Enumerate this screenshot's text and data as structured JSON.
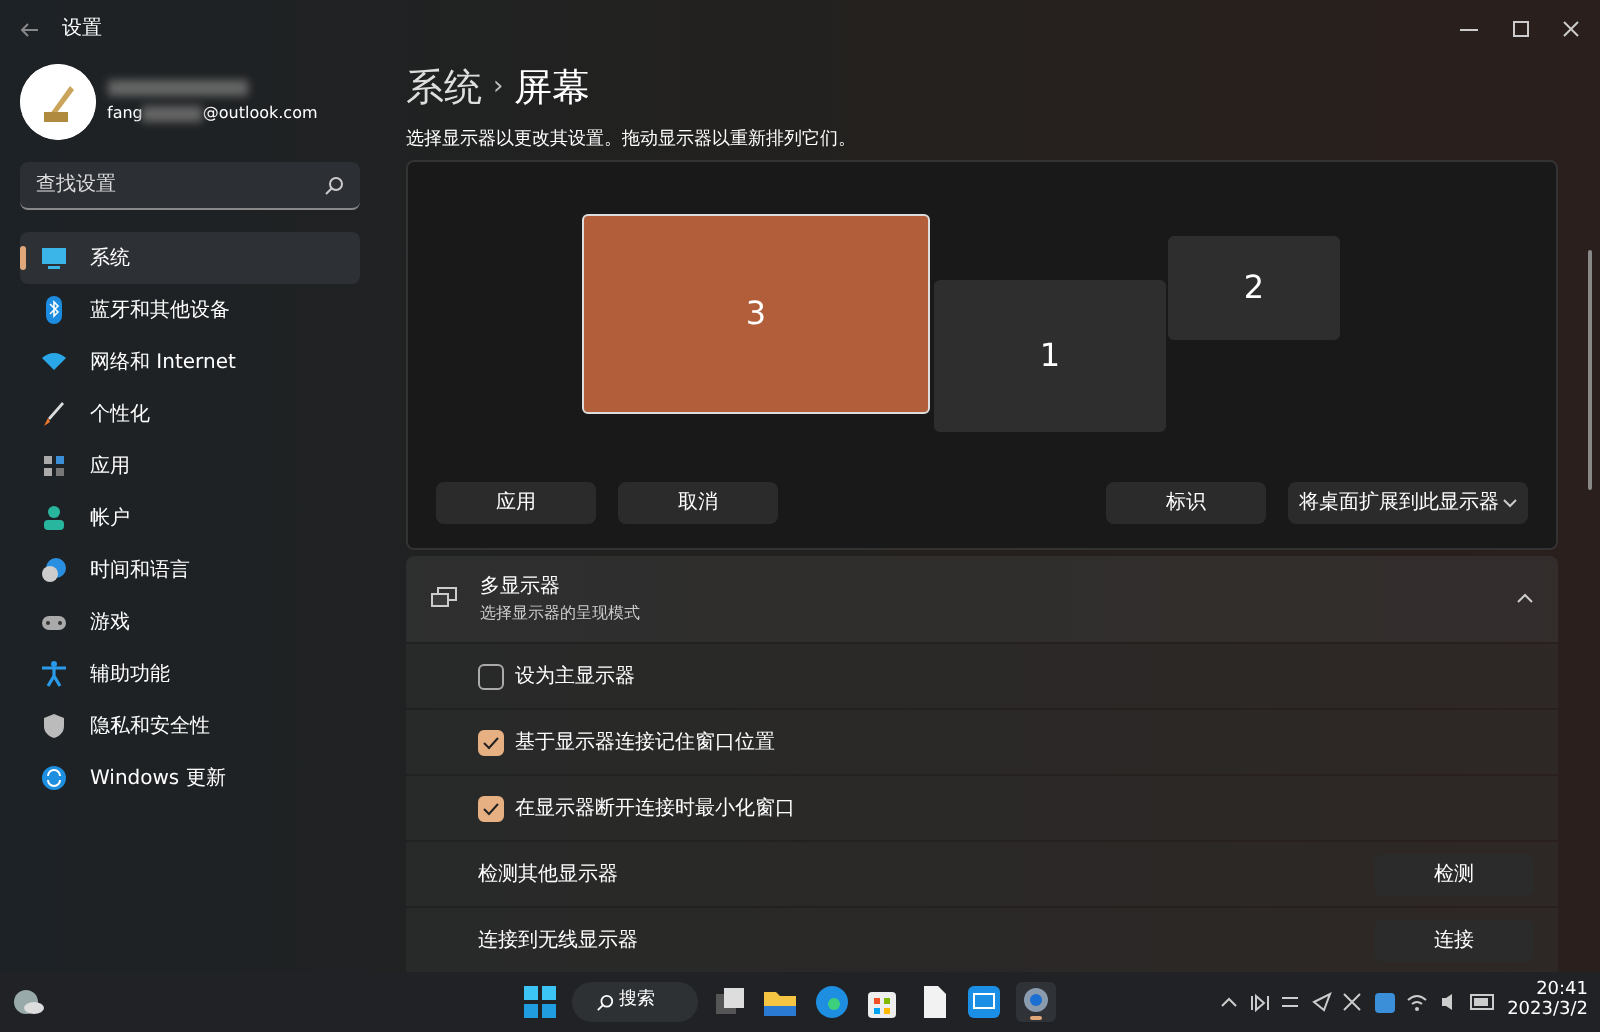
{
  "window": {
    "title": "设置"
  },
  "account": {
    "email_prefix": "fang",
    "email_suffix": "@outlook.com"
  },
  "search": {
    "placeholder": "查找设置"
  },
  "sidebar": {
    "items": [
      {
        "label": "系统",
        "selected": true
      },
      {
        "label": "蓝牙和其他设备",
        "selected": false
      },
      {
        "label": "网络和 Internet",
        "selected": false
      },
      {
        "label": "个性化",
        "selected": false
      },
      {
        "label": "应用",
        "selected": false
      },
      {
        "label": "帐户",
        "selected": false
      },
      {
        "label": "时间和语言",
        "selected": false
      },
      {
        "label": "游戏",
        "selected": false
      },
      {
        "label": "辅助功能",
        "selected": false
      },
      {
        "label": "隐私和安全性",
        "selected": false
      },
      {
        "label": "Windows 更新",
        "selected": false
      }
    ]
  },
  "breadcrumb": {
    "parent": "系统",
    "separator": "›",
    "current": "屏幕"
  },
  "hint": "选择显示器以更改其设置。拖动显示器以重新排列它们。",
  "monitors": [
    {
      "label": "3",
      "selected": true
    },
    {
      "label": "1",
      "selected": false
    },
    {
      "label": "2",
      "selected": false
    }
  ],
  "arrange_buttons": [
    "应用",
    "取消"
  ],
  "identify_button": "标识",
  "mode_dropdown": "将桌面扩展到此显示器",
  "multi_display": {
    "title": "多显示器",
    "subtitle": "选择显示器的呈现模式",
    "expanded": true,
    "rows": [
      {
        "kind": "checkbox",
        "label": "设为主显示器",
        "checked": false
      },
      {
        "kind": "checkbox",
        "label": "基于显示器连接记住窗口位置",
        "checked": true
      },
      {
        "kind": "checkbox",
        "label": "在显示器断开连接时最小化窗口",
        "checked": true
      },
      {
        "kind": "action",
        "label": "检测其他显示器",
        "button": "检测"
      },
      {
        "kind": "action",
        "label": "连接到无线显示器",
        "button": "连接"
      }
    ]
  },
  "taskbar": {
    "search": "搜索",
    "time": "20:41",
    "date": "2023/3/2"
  }
}
